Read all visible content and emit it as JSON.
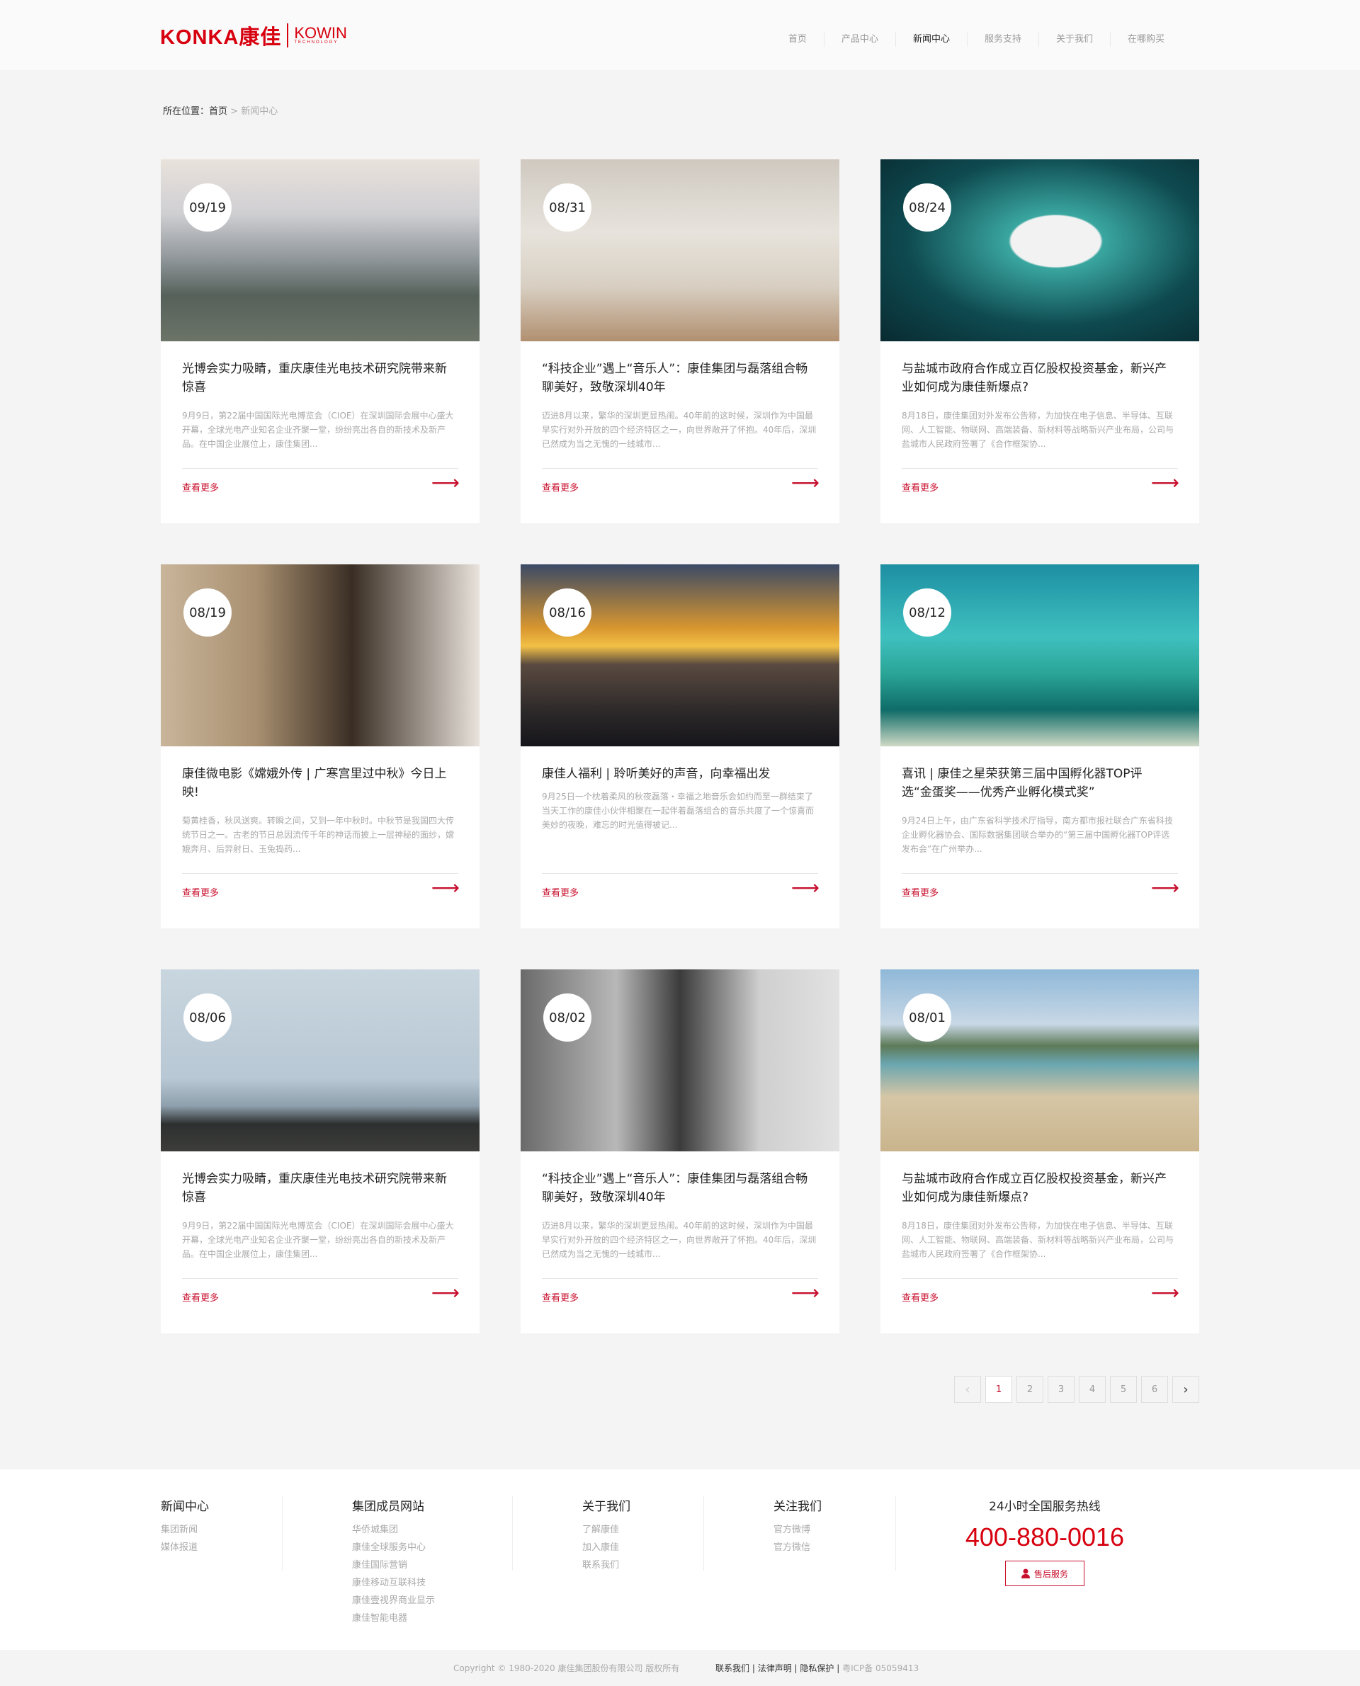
{
  "header": {
    "logo_text": "KONKA康佳",
    "logo_sub": "KOWIN",
    "logo_sub2": "TECHNOLOGY",
    "nav": [
      {
        "label": "首页"
      },
      {
        "label": "产品中心"
      },
      {
        "label": "新闻中心",
        "active": true
      },
      {
        "label": "服务支持"
      },
      {
        "label": "关于我们"
      },
      {
        "label": "在哪购买"
      }
    ]
  },
  "breadcrumb": {
    "prefix": "所在位置：",
    "home": "首页",
    "sep": ">",
    "current": "新闻中心"
  },
  "read_more": "查看更多",
  "cards": [
    {
      "date": "09/19",
      "title": "光博会实力吸睛，重庆康佳光电技术研究院带来新惊喜",
      "excerpt": " 9月9日，第22届中国国际光电博览会（CIOE）在深圳国际会展中心盛大开幕，全球光电产业知名企业齐聚一堂，纷纷亮出各自的新技术及新产品。在中国企业展位上，康佳集团...",
      "img": "city"
    },
    {
      "date": "08/31",
      "title": "“科技企业”遇上“音乐人”：康佳集团与磊落组合畅聊美好，致敬深圳40年",
      "excerpt": "迈进8月以来，繁华的深圳更显热闹。40年前的这时候，深圳作为中国最早实行对外开放的四个经济特区之一，向世界敞开了怀抱。40年后，深圳已然成为当之无愧的一线城市...",
      "img": "room"
    },
    {
      "date": "08/24",
      "title": "与盐城市政府合作成立百亿股权投资基金，新兴产业如何成为康佳新爆点?",
      "excerpt": "8月18日，康佳集团对外发布公告称，为加快在电子信息、半导体、互联网、人工智能、物联网、高端装备、新材料等战略新兴产业布局，公司与盐城市人民政府签署了《合作框架协...",
      "img": "chip"
    },
    {
      "date": "08/19",
      "title": "康佳微电影《嫦娥外传 | 广寒宫里过中秋》今日上映!",
      "excerpt": "菊黄桂香，秋风送爽。转瞬之间，又到一年中秋时。中秋节是我国四大传统节日之一。古老的节日总因流传千年的神话而披上一层神秘的面纱，嫦娥奔月、后羿射日、玉兔捣药...",
      "img": "movie"
    },
    {
      "date": "08/16",
      "title": "康佳人福利 | 聆听美好的声音，向幸福出发",
      "excerpt": "9月25日一个枕着柔风的秋夜磊落・幸福之地音乐会如约而至一群结束了当天工作的康佳小伙伴相聚在一起伴着磊落组合的音乐共度了一个惊喜而美妙的夜晚，难忘的时光值得被记...",
      "img": "sunset"
    },
    {
      "date": "08/12",
      "title": "喜讯 | 康佳之星荣获第三届中国孵化器TOP评选“金蛋奖——优秀产业孵化模式奖”",
      "excerpt": "9月24日上午，由广东省科学技术厅指导，南方都市报社联合广东省科技企业孵化器协会、国际数据集团联合举办的“第三届中国孵化器TOP评选发布会”在广州举办...",
      "img": "sea"
    },
    {
      "date": "08/06",
      "title": "光博会实力吸睛，重庆康佳光电技术研究院带来新惊喜",
      "excerpt": " 9月9日，第22届中国国际光电博览会（CIOE）在深圳国际会展中心盛大开幕，全球光电产业知名企业齐聚一堂，纷纷亮出各自的新技术及新产品。在中国企业展位上，康佳集团...",
      "img": "shore"
    },
    {
      "date": "08/02",
      "title": "“科技企业”遇上“音乐人”：康佳集团与磊落组合畅聊美好，致敬深圳40年",
      "excerpt": "迈进8月以来，繁华的深圳更显热闹。40年前的这时候，深圳作为中国最早实行对外开放的四个经济特区之一，向世界敞开了怀抱。40年后，深圳已然成为当之无愧的一线城市...",
      "img": "book"
    },
    {
      "date": "08/01",
      "title": "与盐城市政府合作成立百亿股权投资基金，新兴产业如何成为康佳新爆点?",
      "excerpt": "8月18日，康佳集团对外发布公告称，为加快在电子信息、半导体、互联网、人工智能、物联网、高端装备、新材料等战略新兴产业布局，公司与盐城市人民政府签署了《合作框架协...",
      "img": "beach"
    }
  ],
  "pagination": {
    "prev": "‹",
    "pages": [
      "1",
      "2",
      "3",
      "4",
      "5",
      "6"
    ],
    "current": "1",
    "next": "›"
  },
  "footer": {
    "cols": [
      {
        "title": "新闻中心",
        "links": [
          "集团新闻",
          "媒体报道"
        ]
      },
      {
        "title": "集团成员网站",
        "links": [
          "华侨城集团",
          "康佳全球服务中心",
          "康佳国际营销",
          "康佳移动互联科技",
          "康佳壹视界商业显示",
          "康佳智能电器"
        ]
      },
      {
        "title": "关于我们",
        "links": [
          "了解康佳",
          "加入康佳",
          "联系我们"
        ]
      },
      {
        "title": "关注我们",
        "links": [
          "官方微博",
          "官方微信"
        ]
      }
    ],
    "hotline_title": "24小时全国服务热线",
    "hotline": "400-880-0016",
    "service_btn": "售后服务",
    "copyright": "Copyright © 1980-2020 康佳集团股份有限公司 版权所有",
    "links": [
      "联系我们",
      "法律声明",
      "隐私保护"
    ],
    "icp": "粤ICP备 05059413"
  },
  "colors": {
    "brand": "#d7000f",
    "accent": "#c8102e"
  }
}
